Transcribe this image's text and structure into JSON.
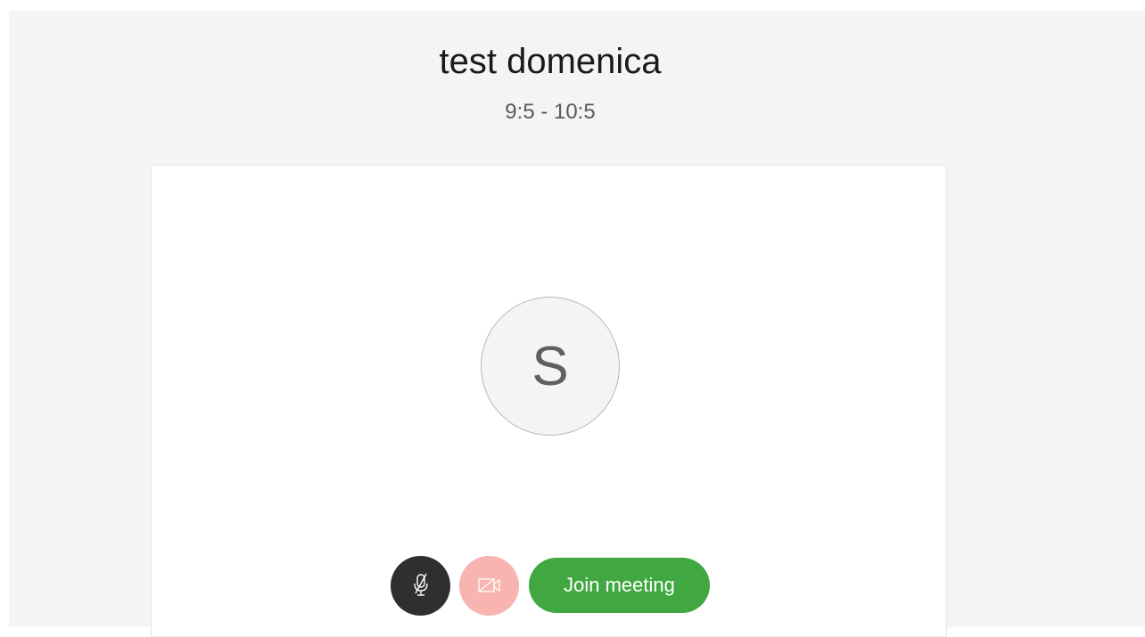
{
  "meeting": {
    "title": "test domenica",
    "time_range": "9:5 - 10:5"
  },
  "preview": {
    "avatar_initial": "S"
  },
  "controls": {
    "mic_icon": "microphone-muted-icon",
    "camera_icon": "camera-off-icon",
    "join_label": "Join meeting"
  },
  "colors": {
    "background": "#f4f4f4",
    "card": "#ffffff",
    "mic_button": "#2f2f2f",
    "camera_button": "#f8b4b0",
    "join_button": "#41a841"
  }
}
